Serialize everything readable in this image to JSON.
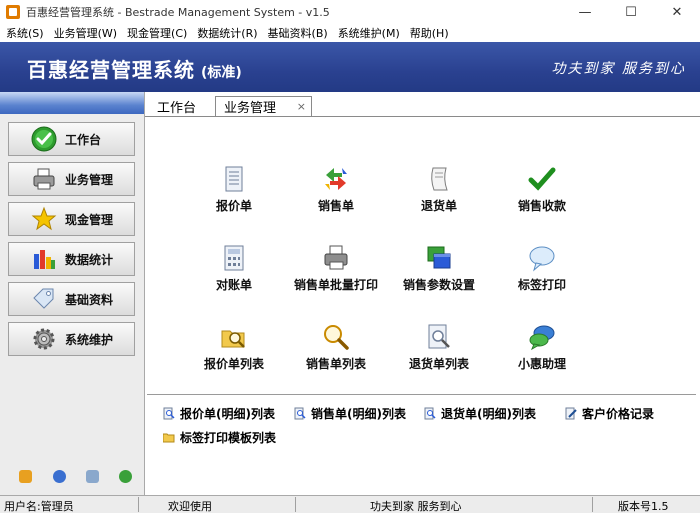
{
  "window": {
    "title": "百惠经营管理系统 - Bestrade Management System - v1.5",
    "minimize": "—",
    "maximize": "☐",
    "close": "✕"
  },
  "menu": {
    "items": [
      {
        "label": "系统(S)"
      },
      {
        "label": "业务管理(W)"
      },
      {
        "label": "现金管理(C)"
      },
      {
        "label": "数据统计(R)"
      },
      {
        "label": "基础资料(B)"
      },
      {
        "label": "系统维护(M)"
      },
      {
        "label": "帮助(H)"
      }
    ]
  },
  "header": {
    "title": "百惠经营管理系统",
    "edition": "(标准)",
    "slogan": "功夫到家 服务到心"
  },
  "sidebar": {
    "items": [
      {
        "label": "工作台",
        "icon": "green-check-icon"
      },
      {
        "label": "业务管理",
        "icon": "printer-icon"
      },
      {
        "label": "现金管理",
        "icon": "star-icon"
      },
      {
        "label": "数据统计",
        "icon": "bar-chart-icon"
      },
      {
        "label": "基础资料",
        "icon": "tag-icon"
      },
      {
        "label": "系统维护",
        "icon": "gear-icon"
      }
    ],
    "tools": [
      "edit-icon",
      "clock-icon",
      "monitor-icon",
      "refresh-icon"
    ]
  },
  "tabs": {
    "home": "工作台",
    "active": "业务管理",
    "close": "×"
  },
  "functions": [
    {
      "label": "报价单",
      "icon": "document-icon"
    },
    {
      "label": "销售单",
      "icon": "recycle-arrows-icon"
    },
    {
      "label": "退货单",
      "icon": "scroll-icon"
    },
    {
      "label": "销售收款",
      "icon": "check-icon"
    },
    {
      "label": "对账单",
      "icon": "calculator-icon"
    },
    {
      "label": "销售单批量打印",
      "icon": "printer-icon"
    },
    {
      "label": "销售参数设置",
      "icon": "windows-icon"
    },
    {
      "label": "标签打印",
      "icon": "speech-bubble-icon"
    },
    {
      "label": "报价单列表",
      "icon": "folder-search-icon"
    },
    {
      "label": "销售单列表",
      "icon": "magnifier-icon"
    },
    {
      "label": "退货单列表",
      "icon": "document-search-icon"
    },
    {
      "label": "小惠助理",
      "icon": "chat-icon"
    }
  ],
  "reports": [
    {
      "label": "报价单(明细)列表",
      "icon": "report-search-icon"
    },
    {
      "label": "销售单(明细)列表",
      "icon": "report-search-icon"
    },
    {
      "label": "退货单(明细)列表",
      "icon": "report-search-icon"
    },
    {
      "label": "客户价格记录",
      "icon": "report-edit-icon"
    },
    {
      "label": "标签打印模板列表",
      "icon": "folder-icon"
    }
  ],
  "status": {
    "user": "用户名:管理员",
    "welcome": "欢迎使用",
    "slogan": "功夫到家 服务到心",
    "version": "版本号1.5"
  }
}
